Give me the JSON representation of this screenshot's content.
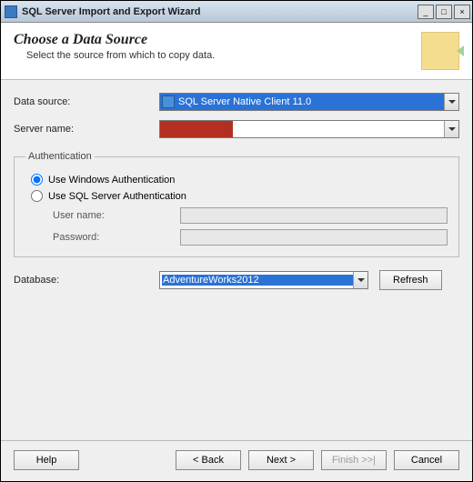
{
  "window": {
    "title": "SQL Server Import and Export Wizard"
  },
  "header": {
    "title": "Choose a Data Source",
    "subtitle": "Select the source from which to copy data."
  },
  "labels": {
    "data_source": "Data source:",
    "server_name": "Server name:",
    "authentication": "Authentication",
    "use_windows_auth": "Use Windows Authentication",
    "use_sql_auth": "Use SQL Server Authentication",
    "user_name": "User name:",
    "password": "Password:",
    "database": "Database:"
  },
  "values": {
    "data_source": "SQL Server Native Client 11.0",
    "server_name": "",
    "auth_mode": "windows",
    "user_name": "",
    "password": "",
    "database": "AdventureWorks2012"
  },
  "buttons": {
    "refresh": "Refresh",
    "help": "Help",
    "back": "< Back",
    "next": "Next >",
    "finish": "Finish >>|",
    "cancel": "Cancel"
  }
}
